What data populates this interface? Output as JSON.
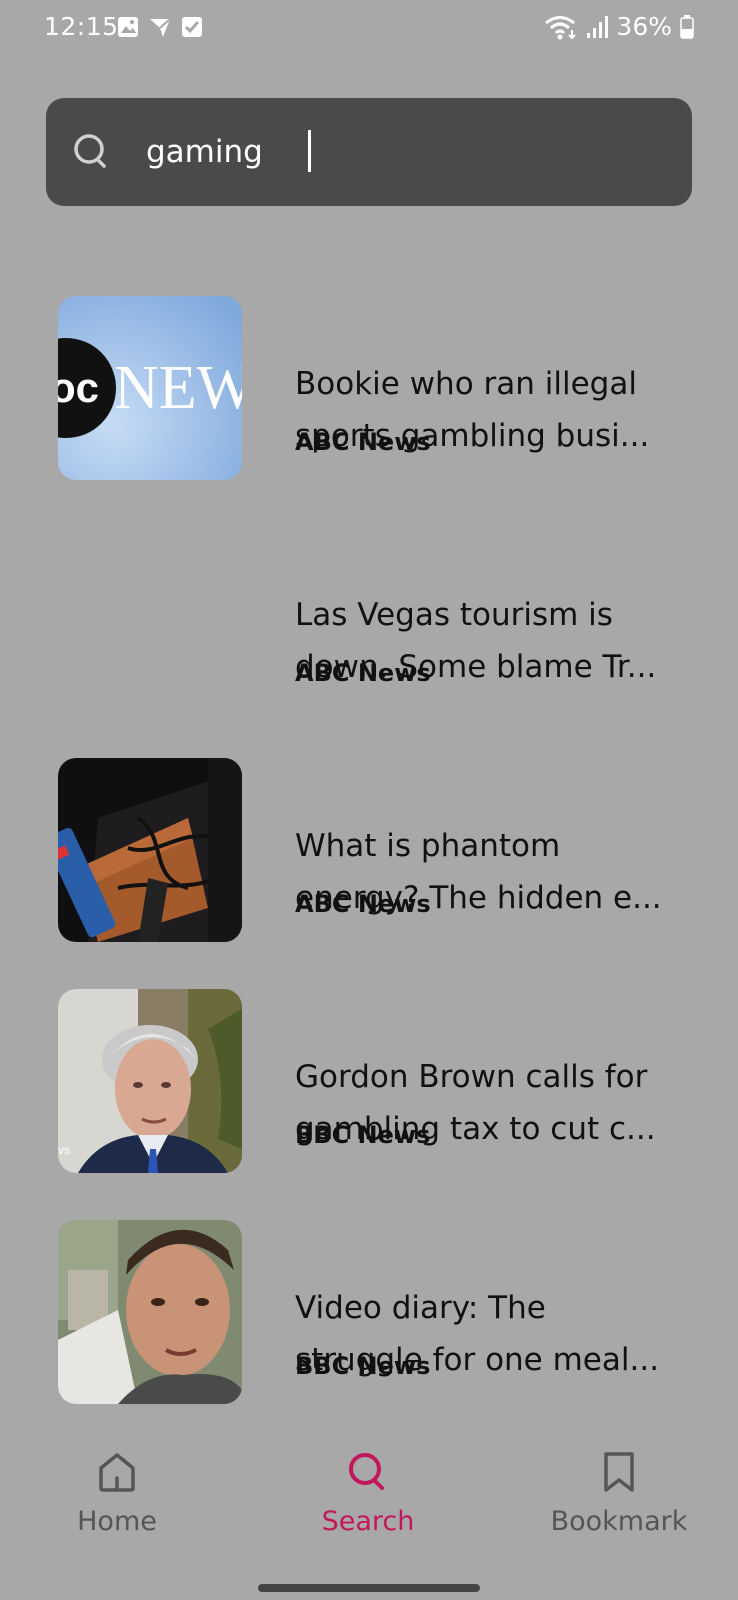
{
  "status_bar": {
    "time": "12:15",
    "battery": "36%",
    "icons": [
      "gallery-icon",
      "send-icon",
      "checkbox-icon",
      "wifi-icon",
      "signal-icon",
      "battery-icon"
    ]
  },
  "search": {
    "value": "gaming",
    "icon": "search-icon"
  },
  "results": [
    {
      "title_line1": "Bookie who ran illegal",
      "title_line2": "sports gambling busi...",
      "source": "ABC News",
      "thumb": "abc-news-logo"
    },
    {
      "title_line1": "Las Vegas tourism is",
      "title_line2": "down. Some blame Tr...",
      "source": "ABC News",
      "thumb": "none"
    },
    {
      "title_line1": "What is phantom",
      "title_line2": "energy? The hidden e...",
      "source": "ABC News",
      "thumb": "power-strip-photo"
    },
    {
      "title_line1": "Gordon Brown calls for",
      "title_line2": "gambling tax to cut c...",
      "source": "BBC News",
      "thumb": "portrait-photo"
    },
    {
      "title_line1": "Video diary: The",
      "title_line2": "struggle for one meal...",
      "source": "BBC News",
      "thumb": "selfie-photo"
    }
  ],
  "thumb_text": {
    "abc_logo": "NEW",
    "bbc_tag": "vs"
  },
  "bottom_nav": {
    "home": "Home",
    "search": "Search",
    "bookmark": "Bookmark",
    "active": "search"
  },
  "colors": {
    "background": "#a8a8a8",
    "search_bar": "#4a4a4c",
    "accent": "#c2185b",
    "nav_inactive": "#555555"
  }
}
